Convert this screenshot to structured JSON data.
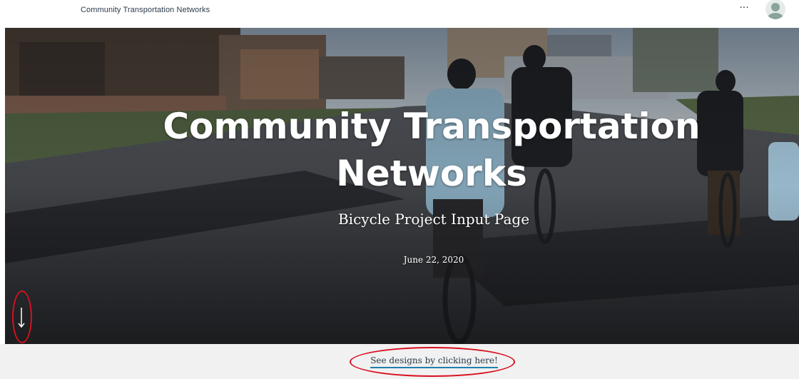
{
  "header": {
    "site_title": "Community Transportation Networks",
    "more_icon": "more-horizontal-icon",
    "more_label": "···",
    "avatar_icon": "user-avatar-icon"
  },
  "hero": {
    "title": "Community Transportation Networks",
    "subtitle": "Bicycle Project Input Page",
    "date": "June 22, 2020",
    "scroll_icon": "arrow-down-icon",
    "background": "photo of cyclists riding on a city street"
  },
  "footer": {
    "link_text": "See designs by clicking here!"
  },
  "colors": {
    "annotation": "#d8101f",
    "link_underline": "#1f7fb0",
    "strip_bg": "#f1f1f1",
    "title_text": "#2b3a4a"
  }
}
